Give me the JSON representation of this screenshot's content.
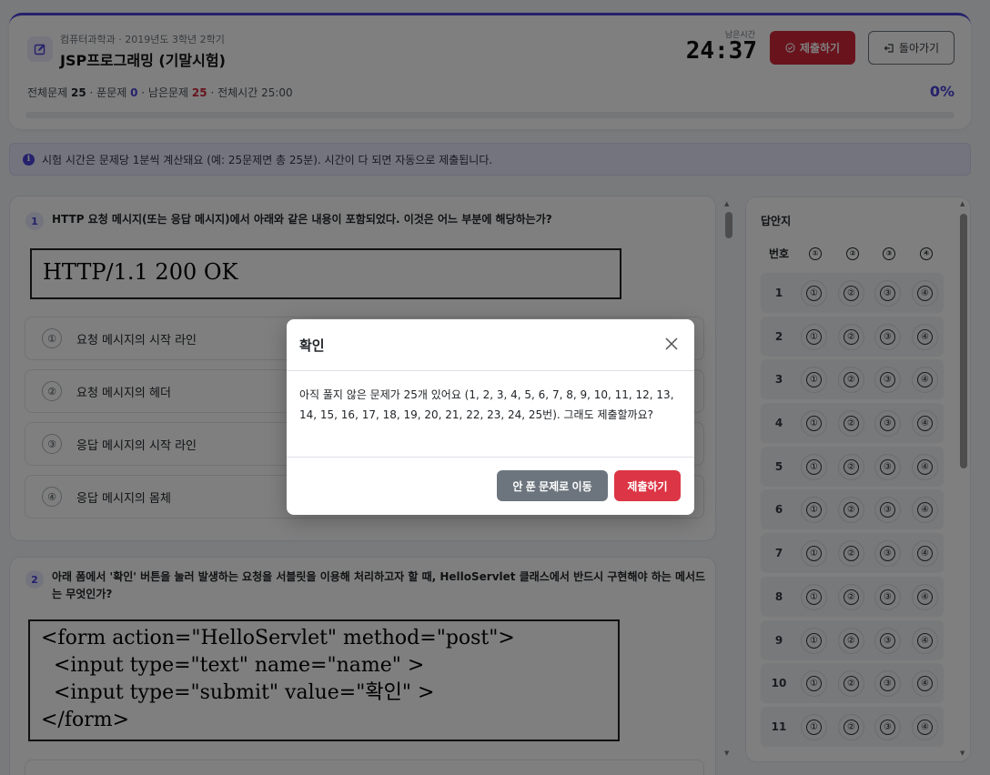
{
  "header": {
    "course_sub": "컴퓨터과학과 · 2019년도 3학년 2학기",
    "title": "JSP프로그래밍 (기말시험)",
    "time_label": "남은시간",
    "time_value": "24:37",
    "submit_label": "제출하기",
    "back_label": "돌아가기",
    "stats": {
      "total_label": "전체문제",
      "total": "25",
      "solved_label": "푼문제",
      "solved": "0",
      "remaining_label": "남은문제",
      "remaining": "25",
      "time_label": "전체시간",
      "time": "25:00"
    },
    "percent": "0%",
    "progress": 0
  },
  "notice": {
    "icon": "info-icon",
    "text": "시험 시간은 문제당 1분씩 계산돼요 (예: 25문제면 총 25분). 시간이 다 되면 자동으로 제출됩니다."
  },
  "questions": [
    {
      "number": "1",
      "text": "HTTP 요청 메시지(또는 응답 메시지)에서 아래와 같은 내용이 포함되었다. 이것은 어느 부분에 해당하는가?",
      "figure": "HTTP/1.1 200 OK",
      "options": [
        {
          "mark": "①",
          "label": "요청 메시지의 시작 라인"
        },
        {
          "mark": "②",
          "label": "요청 메시지의 헤더"
        },
        {
          "mark": "③",
          "label": "응답 메시지의 시작 라인"
        },
        {
          "mark": "④",
          "label": "응답 메시지의 몸체"
        }
      ]
    },
    {
      "number": "2",
      "text": "아래 폼에서 '확인' 버튼을 눌러 발생하는 요청을 서블릿을 이용해 처리하고자 할 때, HelloServlet 클래스에서 반드시 구현해야 하는 메서드는 무엇인가?",
      "figure_lines": [
        "<form action=\"HelloServlet\" method=\"post\">",
        "  <input type=\"text\" name=\"name\" >",
        "  <input type=\"submit\" value=\"확인\" >",
        "</form>"
      ]
    }
  ],
  "answer_sheet": {
    "title": "답안지",
    "num_header": "번호",
    "option_marks": [
      "①",
      "②",
      "③",
      "④"
    ],
    "rows": [
      "1",
      "2",
      "3",
      "4",
      "5",
      "6",
      "7",
      "8",
      "9",
      "10",
      "11"
    ]
  },
  "modal": {
    "title": "확인",
    "body": "아직 풀지 않은 문제가 25개 있어요 (1, 2, 3, 4, 5, 6, 7, 8, 9, 10, 11, 12, 13, 14, 15, 16, 17, 18, 19, 20, 21, 22, 23, 24, 25번). 그래도 제출할까요?",
    "goto_label": "안 푼 문제로 이동",
    "submit_label": "제출하기"
  },
  "colors": {
    "accent": "#4a42d8",
    "danger": "#d2283b",
    "secondary": "#6c757d"
  }
}
